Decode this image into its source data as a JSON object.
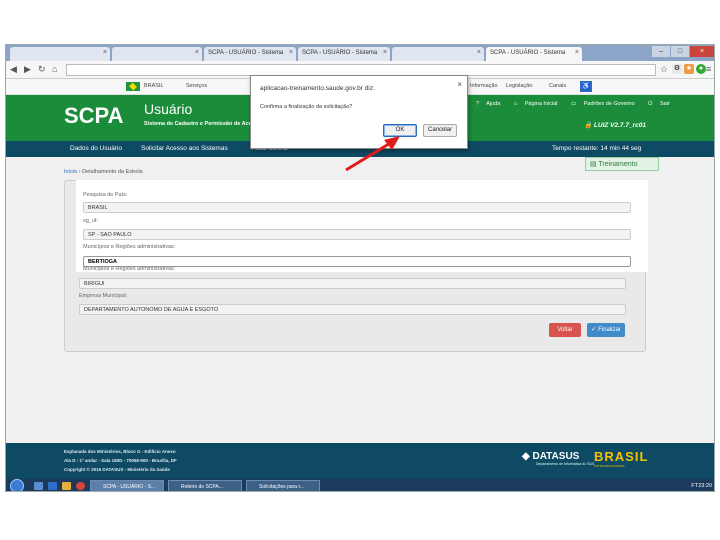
{
  "browser": {
    "tabs": [
      {
        "label": ""
      },
      {
        "label": ""
      },
      {
        "label": "SCPA - USUÁRIO - Sistema"
      },
      {
        "label": "SCPA - USUÁRIO - Sistema"
      },
      {
        "label": ""
      },
      {
        "label": "SCPA - USUÁRIO - Sistema"
      }
    ],
    "url": ""
  },
  "govbar": {
    "brasil": "BRASIL",
    "servicos": "Serviços",
    "informacao": "Informação",
    "legislacao": "Legislação",
    "canais": "Canais"
  },
  "header": {
    "logo": "SCPA",
    "app_name": "Usuário",
    "subtitle": "Sistema de Cadastro e Permissão de Acesso",
    "links": {
      "ajuda": "Ajuda",
      "pagina_inicial": "Página Inicial",
      "padroes": "Padrões de Governo",
      "sair": "Sair"
    },
    "version": "LUIZ V2.7.7_rc01"
  },
  "menu": {
    "dados_usuario": "Dados do Usuário",
    "solicitar_acesso": "Solicitar Acesso aos Sistemas",
    "atual_senha": "Atual Senha",
    "tempo_restante": "Tempo restante: 14 min 44 seg"
  },
  "treinamento": "Treinamento",
  "breadcrumb": {
    "home": "Início",
    "current": "Detalhamento da Estrela"
  },
  "form": {
    "pesquisa_pais_label": "Pesquisa de País:",
    "pais_value": "BRASIL",
    "uf_label": "sg_uf:",
    "uf_value": "SP - SAO PAULO",
    "municipios_label": "Municípios e Regiões administrativas:",
    "municipio_highlight": "BERTIOGA",
    "municipios_label2": "Municípios e Regiões administrativas:",
    "municipio_value": "BIRIGUI",
    "empresa_label": "Empresa Municipal:",
    "empresa_value": "DEPARTAMENTO AUTONOMO DE AGUA E ESGOTO"
  },
  "buttons": {
    "voltar": "Voltar",
    "finalizar": "Finalizar"
  },
  "footer": {
    "line1": "Esplanada dos Ministérios, Bloco G - Edifício Anexo",
    "line2": "Ala D - 1º andar - Sala 180D - 70058-900 - Brasília, DF",
    "line3": "Copyright © 2016 DATASUS - Ministério da Saúde",
    "datasus": "DATASUS",
    "datasus_sub": "Departamento de Informática do SUS",
    "brasil": "BRASIL",
    "brasil_sub": "PÁTRIA EDUCADORA"
  },
  "taskbar": {
    "tasks": [
      {
        "label": "SCPA - USUÁRIO - S..."
      },
      {
        "label": "Roteiro do SCPA..."
      },
      {
        "label": "Solicitações para r..."
      }
    ],
    "tray": "FT",
    "clock": "23:20"
  },
  "dialog": {
    "title": "aplicacao-treinamento.saude.gov.br diz:",
    "message": "Confirma a finalização da solicitação?",
    "ok": "OK",
    "cancel": "Cancelar"
  },
  "colors": {
    "header_green": "#1b8c3a",
    "menu_blue": "#0e4a63",
    "voltar_red": "#d9534f",
    "finalizar_blue": "#428bca",
    "arrow_red": "#e01b1b"
  }
}
